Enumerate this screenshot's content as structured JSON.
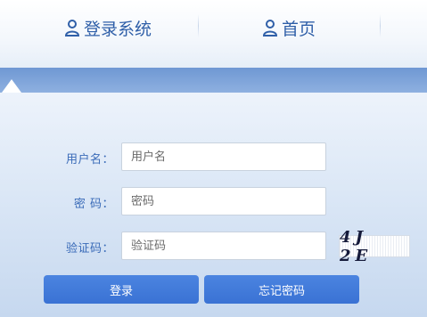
{
  "nav": {
    "login_label": "登录系统",
    "home_label": "首页"
  },
  "form": {
    "username": {
      "label": "用户名：",
      "placeholder": "用户名",
      "value": ""
    },
    "password": {
      "label": "密 码：",
      "placeholder": "密码",
      "value": ""
    },
    "captcha": {
      "label": "验证码：",
      "placeholder": "验证码",
      "value": "",
      "image_text": "4J 2E"
    }
  },
  "buttons": {
    "login": "登录",
    "forgot": "忘记密码"
  },
  "colors": {
    "accent": "#3a72d4",
    "label": "#3a6bb8",
    "band": "#7ea3d9"
  }
}
